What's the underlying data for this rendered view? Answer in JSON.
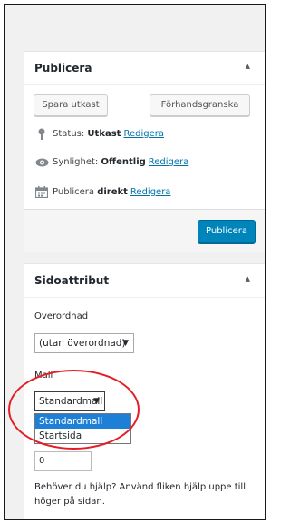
{
  "publish_box": {
    "title": "Publicera",
    "toggle_icon": "triangle-up-icon",
    "save_draft_label": "Spara utkast",
    "preview_label": "Förhandsgranska",
    "status_label": "Status:",
    "status_value": "Utkast",
    "status_edit": "Redigera",
    "visibility_label": "Synlighet:",
    "visibility_value": "Offentlig",
    "visibility_edit": "Redigera",
    "schedule_label": "Publicera",
    "schedule_value": "direkt",
    "schedule_edit": "Redigera",
    "publish_label": "Publicera",
    "primary_color": "#0085ba",
    "link_color": "#0073aa"
  },
  "attributes_box": {
    "title": "Sidoattribut",
    "toggle_icon": "triangle-up-icon",
    "parent_label": "Överordnad",
    "parent_selected": "(utan överordnad)",
    "template_label": "Mall",
    "template_selected": "Standardmall",
    "template_options": [
      "Standardmall",
      "Startsida"
    ],
    "order_value": "0",
    "help_text": "Behöver du hjälp? Använd fliken hjälp uppe till höger på sidan."
  },
  "annotation": {
    "color": "#e41e26",
    "shape": "ellipse"
  }
}
